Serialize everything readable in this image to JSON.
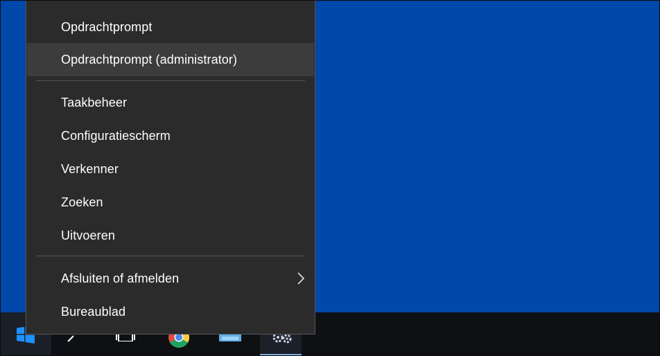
{
  "menu": {
    "items": [
      {
        "label": "Opdrachtprompt"
      },
      {
        "label": "Opdrachtprompt (administrator)"
      },
      {
        "label": "Taakbeheer"
      },
      {
        "label": "Configuratiescherm"
      },
      {
        "label": "Verkenner"
      },
      {
        "label": "Zoeken"
      },
      {
        "label": "Uitvoeren"
      },
      {
        "label": "Afsluiten of afmelden"
      },
      {
        "label": "Bureaublad"
      }
    ]
  },
  "taskbar": {
    "icons": [
      "windows-start-icon",
      "search-icon",
      "task-view-icon",
      "chrome-icon",
      "monitor-app-icon",
      "settings-gears-icon"
    ]
  },
  "colors": {
    "desktop": "#0048a9",
    "menu_bg": "#2b2b2b",
    "menu_hover": "#3c3c3c",
    "taskbar": "#0e1014",
    "start_blue": "#1e90ff"
  }
}
